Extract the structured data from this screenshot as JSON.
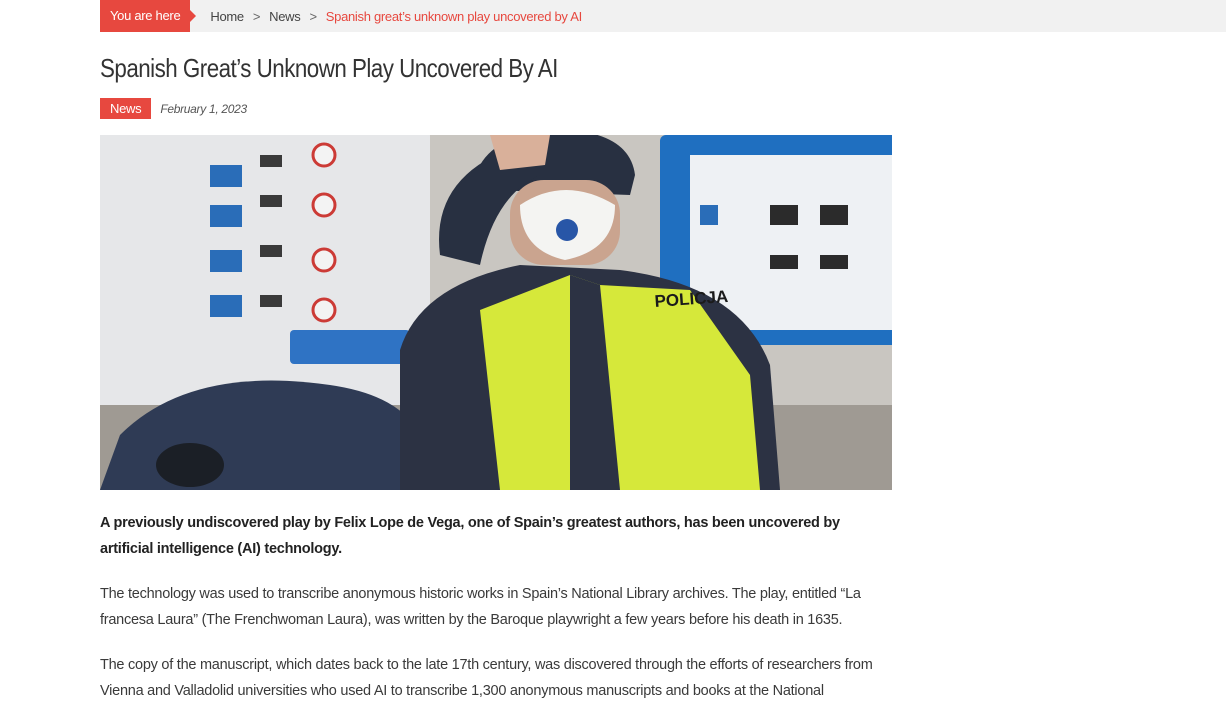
{
  "breadcrumb": {
    "label": "You are here",
    "items": [
      "Home",
      "News"
    ],
    "separator": ">",
    "current": "Spanish great’s unknown play uncovered by AI"
  },
  "article": {
    "title": "Spanish Great’s Unknown Play Uncovered By AI",
    "category": "News",
    "date": "February 1, 2023",
    "image_text": "POLICJA",
    "lead": "A previously undiscovered play by Felix Lope de Vega, one of Spain’s greatest authors, has been uncovered by artificial intelligence (AI) technology.",
    "paragraphs": [
      "The technology was used to transcribe anonymous historic works in Spain’s National Library archives. The play, entitled “La francesa Laura” (The Frenchwoman Laura), was written by the Baroque playwright a few years before his death in 1635.",
      "The copy of the manuscript, which dates back to the late 17th century, was discovered through the efforts of researchers from Vienna and Valladolid universities who used AI to transcribe 1,300 anonymous manuscripts and books at the National"
    ]
  },
  "colors": {
    "accent": "#e7483f",
    "breadcrumb_bg": "#f1f1f1"
  }
}
